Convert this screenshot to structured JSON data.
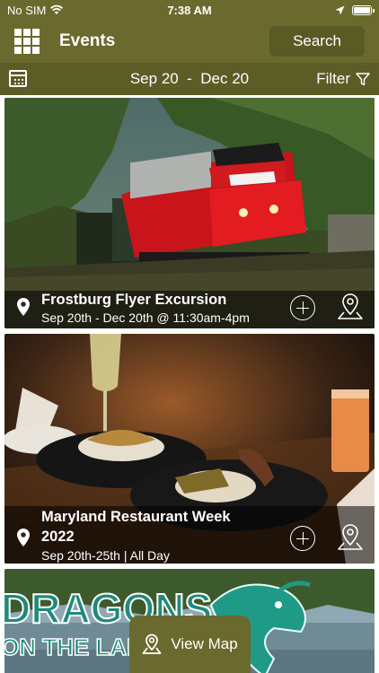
{
  "status": {
    "carrier": "No SIM",
    "time": "7:38 AM"
  },
  "header": {
    "title": "Events",
    "search_label": "Search"
  },
  "datebar": {
    "range": "Sep 20  -  Dec 20",
    "filter_label": "Filter"
  },
  "events": [
    {
      "title": "Frostburg Flyer Excursion",
      "subtitle": "Sep 20th - Dec 20th @ 11:30am-4pm"
    },
    {
      "title_line1": "Maryland Restaurant Week",
      "title_line2": "2022",
      "subtitle": "Sep 20th-25th | All Day"
    },
    {
      "banner_line1": "DRAGONS",
      "banner_line2": "ON THE LAKE"
    }
  ],
  "view_map_label": "View Map",
  "colors": {
    "olive": "#6a6a2e",
    "olive_dark": "#5c5c27",
    "train_red": "#d0151a",
    "dragon_teal": "#1f8a7a"
  }
}
